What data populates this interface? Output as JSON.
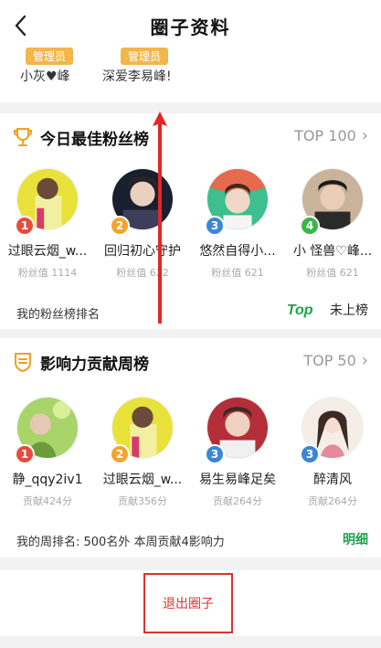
{
  "header": {
    "title": "圈子资料"
  },
  "admins": [
    {
      "badge": "管理员",
      "name": "小灰♥峰"
    },
    {
      "badge": "管理员",
      "name": "深爱李易峰!"
    }
  ],
  "fans_section": {
    "title": "今日最佳粉丝榜",
    "more": "TOP 100",
    "items": [
      {
        "rank": "1",
        "name": "过眼云烟_w...",
        "value": "粉丝值 1114",
        "rank_color": "#e84b3c"
      },
      {
        "rank": "2",
        "name": "回归初心守护",
        "value": "粉丝值 622",
        "rank_color": "#f2a42f"
      },
      {
        "rank": "3",
        "name": "悠然自得小...",
        "value": "粉丝值 621",
        "rank_color": "#3b86d6"
      },
      {
        "rank": "4",
        "name": "小 怪兽♡峰...",
        "value": "粉丝值 621",
        "rank_color": "#3ab54a"
      }
    ],
    "my_rank_label": "我的粉丝榜排名",
    "top_label": "Top",
    "my_rank_value": "未上榜"
  },
  "contrib_section": {
    "title": "影响力贡献周榜",
    "more": "TOP 50",
    "items": [
      {
        "rank": "1",
        "name": "静_qqy2iv1",
        "value": "贡献424分",
        "rank_color": "#e84b3c"
      },
      {
        "rank": "2",
        "name": "过眼云烟_w...",
        "value": "贡献356分",
        "rank_color": "#f2a42f"
      },
      {
        "rank": "3",
        "name": "易生易峰足矣",
        "value": "贡献264分",
        "rank_color": "#3b86d6"
      },
      {
        "rank": "3",
        "name": "醉清风",
        "value": "贡献264分",
        "rank_color": "#3b86d6"
      }
    ],
    "my_week_rank": "我的周排名: 500名外   本周贡献4影响力",
    "detail_label": "明细"
  },
  "exit": {
    "label": "退出圈子"
  },
  "colors": {
    "accent_green": "#1aa34a",
    "exit_red": "#e03030",
    "admin_badge": "#f3b64b"
  }
}
